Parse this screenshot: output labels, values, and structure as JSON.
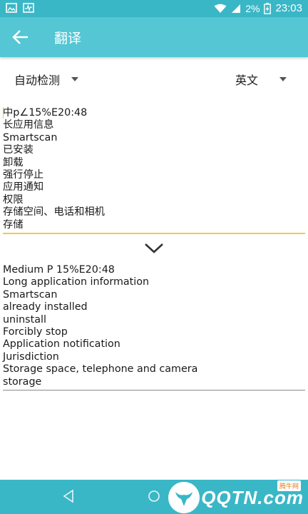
{
  "status_bar": {
    "battery_text": "2%",
    "time": "23:03"
  },
  "app_bar": {
    "title": "翻译"
  },
  "languages": {
    "source": "自动检测",
    "target": "英文"
  },
  "source_text": {
    "lines": [
      "中p∠15%E20:48",
      "长应用信息",
      "Smartscan",
      "已安装",
      "卸载",
      "强行停止",
      "应用通知",
      "权限",
      "存储空间、电话和相机",
      "存储"
    ]
  },
  "translation": {
    "lines": [
      "Medium P 15%E20:48",
      "Long application information",
      "Smartscan",
      "already installed",
      "uninstall",
      "Forcibly stop",
      "Application notification",
      "Jurisdiction",
      "Storage space, telephone and camera",
      "storage"
    ]
  },
  "watermark": {
    "brand": "QQTN.com",
    "tag": "腾牛网"
  },
  "colors": {
    "status_bar": "#3ab7c6",
    "app_bar": "#54c6d4",
    "input_underline": "#f2c94c",
    "nav_bar": "#3ab7c6"
  }
}
